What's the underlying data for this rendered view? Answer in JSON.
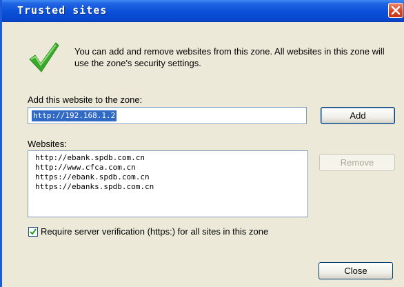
{
  "dialog": {
    "title": "Trusted sites",
    "description": "You can add and remove websites from this zone. All websites in this zone will use the zone's security settings."
  },
  "add_section": {
    "label": "Add this website to the zone:",
    "input_value": "http://192.168.1.2",
    "add_button": "Add"
  },
  "websites_section": {
    "label": "Websites:",
    "items": [
      "http://ebank.spdb.com.cn",
      "http://www.cfca.com.cn",
      "https://ebank.spdb.com.cn",
      "https://ebanks.spdb.com.cn"
    ],
    "remove_button": "Remove"
  },
  "verification": {
    "checked": true,
    "label": "Require server verification (https:) for all sites in this zone"
  },
  "footer": {
    "close_button": "Close"
  },
  "colors": {
    "titlebar": "#0a4fd8",
    "selection": "#316ac5",
    "check_icon": "#3aa82c"
  },
  "icons": [
    "close-icon",
    "checkmark-icon",
    "checkbox-check-icon"
  ]
}
